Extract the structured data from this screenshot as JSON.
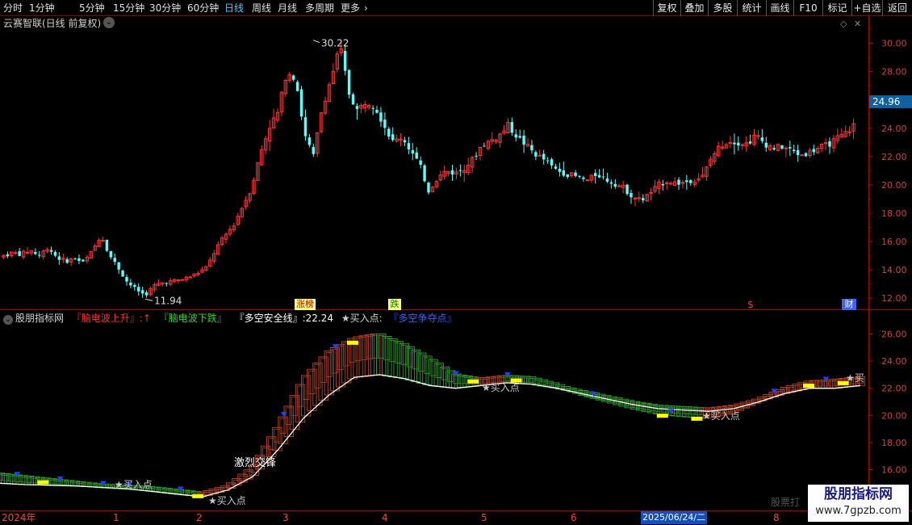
{
  "toolbar": {
    "periods": [
      "分时",
      "1分钟",
      "5分钟",
      "15分钟",
      "30分钟",
      "60分钟",
      "日线",
      "周线",
      "月线",
      "多周期",
      "更多"
    ],
    "active_period": "日线",
    "more_arrow": "›",
    "right_buttons": [
      "复权",
      "叠加",
      "多股",
      "统计",
      "画线",
      "F10",
      "标记",
      "+自选",
      "返回"
    ]
  },
  "main_panel": {
    "stock_title": "云赛智联(日线 前复权)",
    "high_label": "30.22",
    "low_label": "11.94",
    "current_price_tag": "24.96",
    "events": [
      "涨榜",
      "跌",
      "$",
      "财"
    ]
  },
  "indicator_panel": {
    "name": "股朋指标网",
    "legend_up": "『脑电波上升』:↑",
    "legend_down": "『脑电波下跌』",
    "legend_safe": "『多空安全线』:22.24",
    "legend_buy": "★买入点:",
    "legend_contest": "『多空争夺点』",
    "annotation": "激烈交锋",
    "buy_labels": [
      "★买入点",
      "★买入点",
      "★买入点",
      "★买入点",
      "★买入点",
      "★买"
    ]
  },
  "time_axis": {
    "labels": [
      "2024年",
      "1",
      "2",
      "3",
      "4",
      "5",
      "6",
      "8"
    ],
    "selected_date": "2025/06/24/二",
    "faded_text": "股票打"
  },
  "watermark": {
    "line1": "股朋指标网",
    "line2": "www.7gpzb.com"
  },
  "colors": {
    "up": "#ff3232",
    "down": "#54ffff",
    "safe_line": "#ffffff",
    "ladder_up": "#b04020",
    "ladder_down": "#2a9a2a",
    "axis": "#c00000",
    "accent_blue": "#4fc3ff"
  },
  "chart_data": [
    {
      "type": "candlestick",
      "title": "云赛智联(日线 前复权)",
      "ylim": [
        11.5,
        31
      ],
      "yticks": [
        12.0,
        14.0,
        16.0,
        18.0,
        20.0,
        22.0,
        24.0,
        26.0,
        28.0,
        30.0
      ],
      "close_path": [
        15.0,
        15.2,
        15.1,
        15.4,
        15.0,
        15.6,
        14.9,
        14.6,
        14.8,
        14.5,
        15.3,
        16.5,
        15.0,
        14.1,
        13.1,
        12.6,
        12.2,
        12.9,
        13.1,
        13.2,
        13.3,
        13.5,
        13.8,
        14.2,
        15.5,
        16.4,
        17.2,
        18.5,
        19.8,
        22.2,
        24.1,
        25.1,
        28.1,
        27.5,
        23.5,
        22.0,
        25.5,
        27.5,
        29.8,
        26.5,
        25.2,
        26.0,
        25.5,
        24.2,
        23.0,
        23.4,
        22.4,
        21.4,
        19.6,
        20.5,
        21.0,
        20.8,
        21.2,
        21.8,
        22.8,
        23.1,
        23.5,
        24.2,
        23.4,
        22.8,
        22.2,
        21.8,
        21.2,
        20.9,
        20.7,
        20.5,
        20.3,
        20.8,
        20.4,
        20.1,
        19.8,
        19.2,
        18.9,
        19.4,
        20.0,
        20.3,
        20.1,
        20.2,
        20.4,
        20.6,
        22.0,
        22.8,
        23.1,
        23.0,
        22.9,
        23.5,
        22.9,
        22.6,
        22.7,
        22.4,
        22.1,
        22.3,
        22.6,
        22.8,
        23.2,
        23.6,
        24.2
      ],
      "high": 30.22,
      "low": 11.94,
      "current": 24.96
    },
    {
      "type": "line",
      "title": "股朋指标网",
      "ylim": [
        14.9,
        26.8
      ],
      "yticks": [
        16.0,
        18.0,
        20.0,
        22.0,
        24.0,
        26.0
      ],
      "safe_line": [
        15.0,
        14.9,
        14.85,
        14.8,
        14.7,
        14.6,
        14.4,
        14.2,
        14.0,
        14.5,
        15.5,
        17.5,
        19.8,
        21.5,
        22.8,
        23.0,
        22.7,
        22.2,
        22.0,
        22.2,
        22.4,
        22.3,
        22.0,
        21.6,
        21.2,
        20.8,
        20.5,
        20.4,
        20.3,
        20.5,
        21.0,
        21.6,
        22.0,
        22.0,
        22.2
      ],
      "brainwave": [
        15.5,
        15.3,
        15.1,
        14.9,
        14.7,
        14.6,
        14.5,
        14.3,
        14.1,
        14.6,
        16.0,
        19.0,
        22.5,
        24.5,
        25.5,
        25.8,
        25.0,
        24.0,
        22.8,
        22.5,
        22.7,
        22.6,
        22.1,
        21.5,
        21.0,
        20.5,
        20.1,
        19.9,
        19.8,
        20.2,
        21.0,
        21.8,
        22.3,
        22.4,
        22.6
      ]
    }
  ]
}
